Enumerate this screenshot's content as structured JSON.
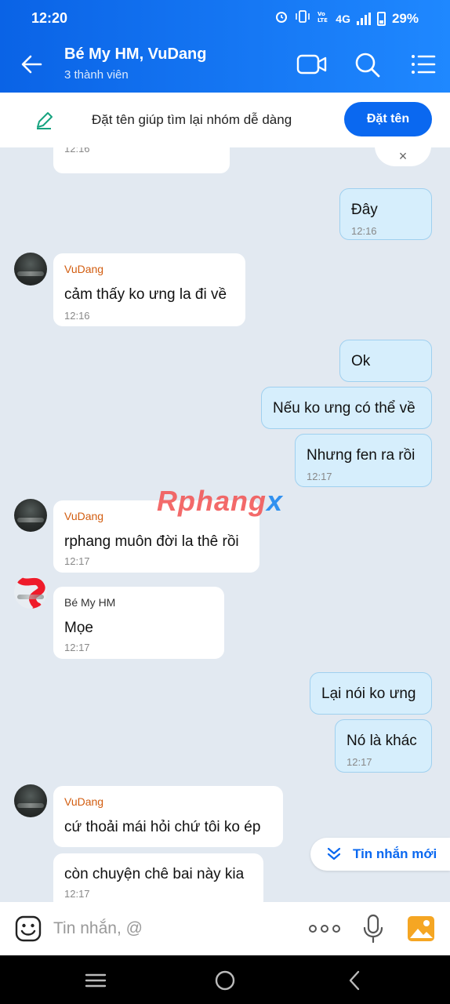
{
  "status_bar": {
    "time": "12:20",
    "network": "4G",
    "battery": "29%"
  },
  "header": {
    "title": "Bé My HM, VuDang",
    "subtitle": "3 thành viên"
  },
  "banner": {
    "text": "Đặt tên giúp tìm lại nhóm dễ dàng",
    "button_label": "Đặt tên",
    "close_label": "×"
  },
  "messages": [
    {
      "sender": "",
      "text": "",
      "time": "12:16",
      "direction": "in"
    },
    {
      "sender": "",
      "text": "Đây",
      "time": "12:16",
      "direction": "out"
    },
    {
      "sender": "VuDang",
      "text": "cảm thấy ko ưng la đi về",
      "time": "12:16",
      "direction": "in"
    },
    {
      "sender": "",
      "text": "Ok",
      "time": "",
      "direction": "out"
    },
    {
      "sender": "",
      "text": "Nếu ko ưng có thể về",
      "time": "",
      "direction": "out"
    },
    {
      "sender": "",
      "text": "Nhưng fen ra rồi",
      "time": "12:17",
      "direction": "out"
    },
    {
      "sender": "VuDang",
      "text": "rphang muôn đời la thê rồi",
      "time": "12:17",
      "direction": "in"
    },
    {
      "sender": "Bé My HM",
      "text": "Mọe",
      "time": "12:17",
      "direction": "in"
    },
    {
      "sender": "",
      "text": "Lại nói ko ưng",
      "time": "",
      "direction": "out"
    },
    {
      "sender": "",
      "text": "Nó là khác",
      "time": "12:17",
      "direction": "out"
    },
    {
      "sender": "VuDang",
      "text": "cứ thoải mái hỏi chứ tôi ko ép",
      "time": "",
      "direction": "in"
    },
    {
      "sender": "",
      "text": "còn chuyện chê bai này kia",
      "time": "12:17",
      "direction": "in"
    }
  ],
  "watermark": {
    "part1": "Rphang",
    "part2": "x"
  },
  "new_messages_label": "Tin nhắn mới",
  "input": {
    "placeholder": "Tin nhắn, @"
  },
  "colors": {
    "header": "#0a63e6",
    "accent": "#0a68f0",
    "sender_name": "#d25d10",
    "outgoing_bubble": "#d6eefc",
    "chat_background": "#e2e9f1"
  }
}
